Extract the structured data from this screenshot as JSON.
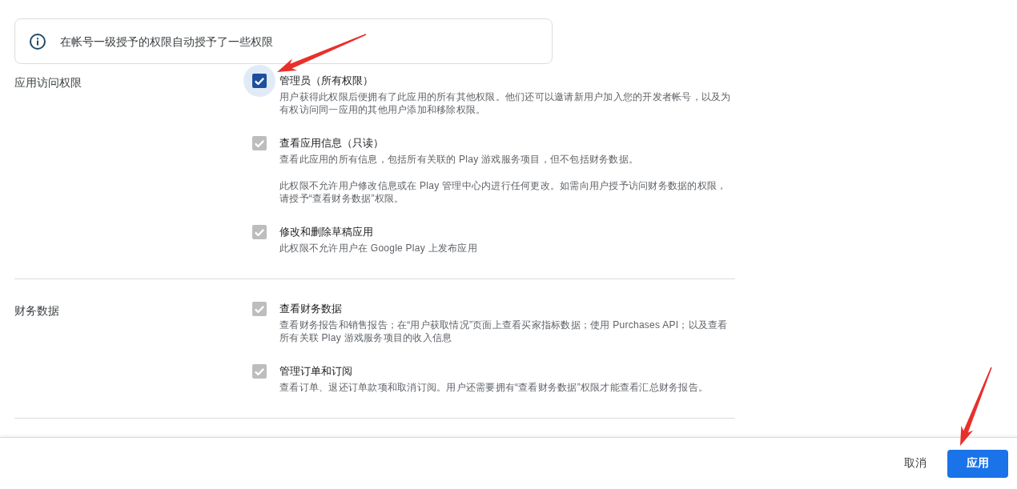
{
  "info_banner": {
    "text": "在帐号一级授予的权限自动授予了一些权限"
  },
  "sections": [
    {
      "label": "应用访问权限",
      "items": [
        {
          "title": "管理员（所有权限）",
          "description": [
            "用户获得此权限后便拥有了此应用的所有其他权限。他们还可以邀请新用户加入您的开发者帐号，以及为有权访问同一应用的其他用户添加和移除权限。"
          ],
          "checked": true,
          "disabled": false,
          "focused": true
        },
        {
          "title": "查看应用信息（只读）",
          "description": [
            "查看此应用的所有信息，包括所有关联的 Play 游戏服务项目，但不包括财务数据。",
            "此权限不允许用户修改信息或在 Play 管理中心内进行任何更改。如需向用户授予访问财务数据的权限，请授予“查看财务数据”权限。"
          ],
          "checked": true,
          "disabled": true,
          "focused": false
        },
        {
          "title": "修改和删除草稿应用",
          "description": [
            "此权限不允许用户在 Google Play 上发布应用"
          ],
          "checked": true,
          "disabled": true,
          "focused": false
        }
      ]
    },
    {
      "label": "财务数据",
      "items": [
        {
          "title": "查看财务数据",
          "description": [
            "查看财务报告和销售报告；在“用户获取情况”页面上查看买家指标数据；使用 Purchases API；以及查看所有关联 Play 游戏服务项目的收入信息"
          ],
          "checked": true,
          "disabled": true,
          "focused": false
        },
        {
          "title": "管理订单和订阅",
          "description": [
            "查看订单、退还订单款项和取消订阅。用户还需要拥有“查看财务数据”权限才能查看汇总财务报告。"
          ],
          "checked": true,
          "disabled": true,
          "focused": false
        }
      ]
    }
  ],
  "footer": {
    "buttons": [
      {
        "label": "取消",
        "kind": "text"
      },
      {
        "label": "应用",
        "kind": "filled"
      }
    ]
  }
}
